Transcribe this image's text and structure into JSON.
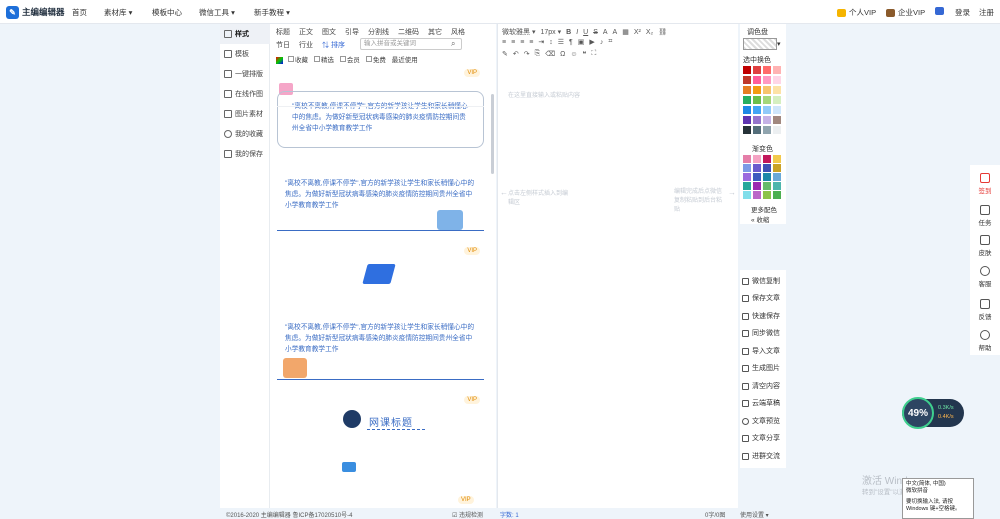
{
  "nav": {
    "logo": "主编编辑器",
    "items": [
      "首页",
      "素材库 ▾",
      "模板中心",
      "微信工具 ▾",
      "新手教程 ▾"
    ],
    "personal_vip": "个人VIP",
    "enterprise_vip": "企业VIP",
    "login": "登录",
    "register": "注册"
  },
  "left_menu": [
    "样式",
    "模板",
    "一键排版",
    "在线作图",
    "图片素材",
    "我的收藏",
    "我的保存"
  ],
  "center": {
    "row1": [
      "标题",
      "正文",
      "图文",
      "引导",
      "分割线",
      "二维码",
      "其它",
      "风格"
    ],
    "row2": [
      "节日",
      "行业"
    ],
    "sort_label": "排序",
    "search_placeholder": "输入拼音或关键词",
    "filters": [
      "收藏",
      "精选",
      "会员",
      "免费",
      "最近使用"
    ],
    "vip_label": "VIP",
    "card_text": "\"离校不离教,停课不停学\",官方的新型冠状病毒感染的肺炎疫情防控期间贵州全省中小学教育教学工作",
    "card_text_full": "\"离校不离教,停课不停学\",官方的新学孩让学生和家长稍懂心中的焦虑。为做好新型冠状病毒感染的肺炎疫情防控期间贵州全省中小学教育教学工作",
    "course_title": "网课标题"
  },
  "editor": {
    "font_family": "微软雅黑",
    "font_size": "17px",
    "placeholder_top": "在这里直接输入或粘贴内容",
    "placeholder_left": "点击左侧样式插入到编辑区",
    "placeholder_right": "编辑完成后点微信复制粘贴到后台粘贴"
  },
  "palette": {
    "title": "调色盘",
    "select_label": "选中换色",
    "gradient_label": "渐变色",
    "more_label": "更多配色",
    "collapse_label": "收缩",
    "colors": [
      "#c00000",
      "#e04040",
      "#ff6b6b",
      "#ffb3b3",
      "#c0392b",
      "#ff5e99",
      "#ff99c2",
      "#ffd6e7",
      "#e67e22",
      "#f39c12",
      "#f7c46c",
      "#fde2a6",
      "#27ae60",
      "#6abf4b",
      "#a5d77a",
      "#d5efc1",
      "#1e88e5",
      "#42a5f5",
      "#90caf9",
      "#cfe6fb",
      "#5e35b1",
      "#9575cd",
      "#c5b2e6",
      "#a1887f",
      "#263238",
      "#546e7a",
      "#90a4ae",
      "#eceff1"
    ],
    "gradients": [
      "#e57ea8",
      "#f5a3c3",
      "#c2185b",
      "#f2c94c",
      "#7e9ae6",
      "#6a5acd",
      "#3f51b5",
      "#c9a227",
      "#9c6ade",
      "#3c5bbf",
      "#1e88a8",
      "#6aa9d8",
      "#26a69a",
      "#9c27b0",
      "#66bb6a",
      "#4db6ac",
      "#80deea",
      "#ba68c8",
      "#8bc34a",
      "#4caf50"
    ]
  },
  "actions": [
    "微信复制",
    "保存文章",
    "快速保存",
    "同步微信",
    "导入文章",
    "生成图片",
    "清空内容",
    "云端草稿",
    "文章预览",
    "文章分享",
    "进群交流"
  ],
  "right_bar": [
    "签到",
    "任务",
    "皮肤",
    "客服",
    "反馈",
    "帮助"
  ],
  "footer": {
    "copyright": "©2016-2020 主编编辑器 鲁ICP备17020510号-4",
    "check": "违规检测",
    "word_count": "字数: 1",
    "char_label": "0字/0图",
    "settings": "使用设置 ▾"
  },
  "gauge": {
    "percent": "49%",
    "up": "0.3K/s",
    "down": "0.4K/s"
  },
  "windows": {
    "activate": "激活 Windows",
    "hint": "转到\"设置\"以激活 Windows。",
    "ime_line1": "中文(简体, 中国)",
    "ime_line2": "微软拼音",
    "ime_line3": "要切换输入法, 请按",
    "ime_line4": "Windows 键+空格键。"
  }
}
